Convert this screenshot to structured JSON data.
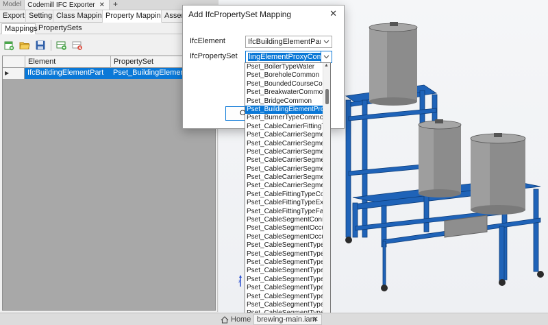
{
  "top_tabs": {
    "model": "Model",
    "exporter": "Codemill IFC Exporter",
    "close": "✕",
    "add": "+"
  },
  "main_tabs": [
    "Export",
    "Settings",
    "Class Mappings",
    "Property Mappings",
    "Assemb"
  ],
  "sub_tabs": [
    "Mappings",
    "PropertySets"
  ],
  "toolbar": {
    "icons": [
      "new-mapping-icon",
      "open-folder-icon",
      "save-disk-icon",
      "add-row-icon",
      "delete-row-icon"
    ]
  },
  "grid": {
    "columns": [
      "Element",
      "PropertySet"
    ],
    "rows": [
      {
        "element": "IfcBuildingElementPart",
        "property_set": "Pset_BuildingElementProxyCommon"
      }
    ]
  },
  "dialog": {
    "title": "Add IfcPropertySet Mapping",
    "close": "✕",
    "ifc_element_label": "IfcElement",
    "ifc_element_value": "IfcBuildingElementPart",
    "ifc_property_set_label": "IfcPropertySet",
    "ifc_property_set_value": "lingElementProxyCommon",
    "ok_label": "OK"
  },
  "dropdown": {
    "selected_index": 5,
    "items": [
      "Pset_BoilerTypeWater",
      "Pset_BoreholeCommon",
      "Pset_BoundedCourseComm",
      "Pset_BreakwaterCommon",
      "Pset_BridgeCommon",
      "Pset_BuildingElementProxy",
      "Pset_BurnerTypeCommon",
      "Pset_CableCarrierFittingTyp",
      "Pset_CableCarrierSegment",
      "Pset_CableCarrierSegment",
      "Pset_CableCarrierSegment",
      "Pset_CableCarrierSegment",
      "Pset_CableCarrierSegment",
      "Pset_CableCarrierSegment",
      "Pset_CableCarrierSegment",
      "Pset_CableFittingTypeComm",
      "Pset_CableFittingTypeExit",
      "Pset_CableFittingTypeFano",
      "Pset_CableSegmentConnect",
      "Pset_CableSegmentOccurre",
      "Pset_CableSegmentOccurre",
      "Pset_CableSegmentTypeBu",
      "Pset_CableSegmentTypeCa",
      "Pset_CableSegmentTypeCo",
      "Pset_CableSegmentTypeCo",
      "Pset_CableSegmentTypeCo",
      "Pset_CableSegmentTypeCo",
      "Pset_CableSegmentTypeEa",
      "Pset_CableSegmentTypeFib",
      "Pset_CableSegmentTypeFib"
    ]
  },
  "status": {
    "home": "Home",
    "document_tab": "brewing-main.iam",
    "close": "✕"
  },
  "colors": {
    "accent": "#0a78d7",
    "frame_blue": "#1f63b8",
    "tank_gray": "#8c8c8c"
  }
}
